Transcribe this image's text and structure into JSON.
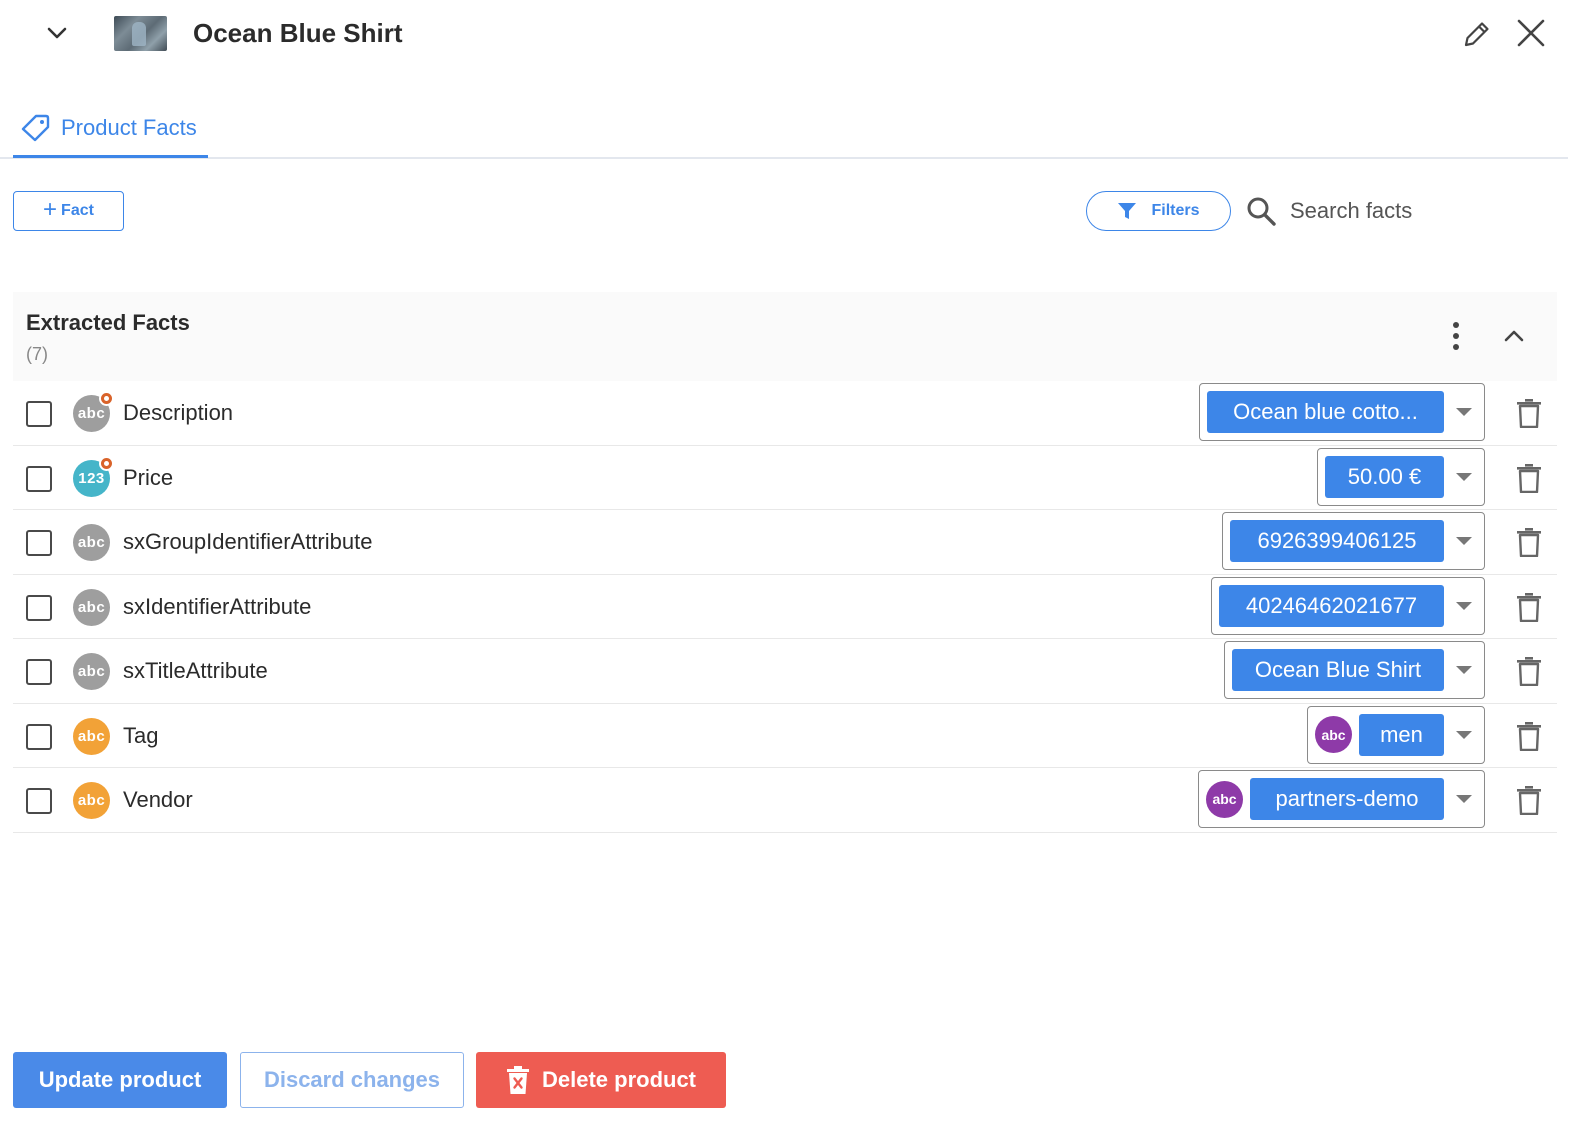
{
  "header": {
    "title": "Ocean Blue Shirt"
  },
  "tabs": [
    {
      "label": "Product Facts",
      "icon": "tag-icon",
      "active": true
    }
  ],
  "toolbar": {
    "add_fact_label": "Fact",
    "filters_label": "Filters",
    "search_placeholder": "Search facts"
  },
  "section": {
    "title": "Extracted Facts",
    "count": "(7)"
  },
  "facts": [
    {
      "name": "Description",
      "type": "abc",
      "type_color": "gray",
      "modified": true,
      "value": "Ocean blue cotto...",
      "value_badge": ""
    },
    {
      "name": "Price",
      "type": "123",
      "type_color": "teal",
      "modified": true,
      "value": "50.00 €",
      "value_badge": ""
    },
    {
      "name": "sxGroupIdentifierAttribute",
      "type": "abc",
      "type_color": "gray",
      "modified": false,
      "value": "6926399406125",
      "value_badge": ""
    },
    {
      "name": "sxIdentifierAttribute",
      "type": "abc",
      "type_color": "gray",
      "modified": false,
      "value": "40246462021677",
      "value_badge": ""
    },
    {
      "name": "sxTitleAttribute",
      "type": "abc",
      "type_color": "gray",
      "modified": false,
      "value": "Ocean Blue Shirt",
      "value_badge": ""
    },
    {
      "name": "Tag",
      "type": "abc",
      "type_color": "orange",
      "modified": false,
      "value": "men",
      "value_badge": "abc"
    },
    {
      "name": "Vendor",
      "type": "abc",
      "type_color": "orange",
      "modified": false,
      "value": "partners-demo",
      "value_badge": "abc"
    }
  ],
  "footer": {
    "update_label": "Update product",
    "discard_label": "Discard changes",
    "delete_label": "Delete product"
  },
  "colors": {
    "accent": "#3d86e8",
    "danger": "#ee5c52",
    "badge_gray": "#9e9e9e",
    "badge_teal": "#45b5c9",
    "badge_orange": "#f2a237",
    "badge_purple": "#8e3aa8",
    "modified_dot": "#d9632a"
  }
}
